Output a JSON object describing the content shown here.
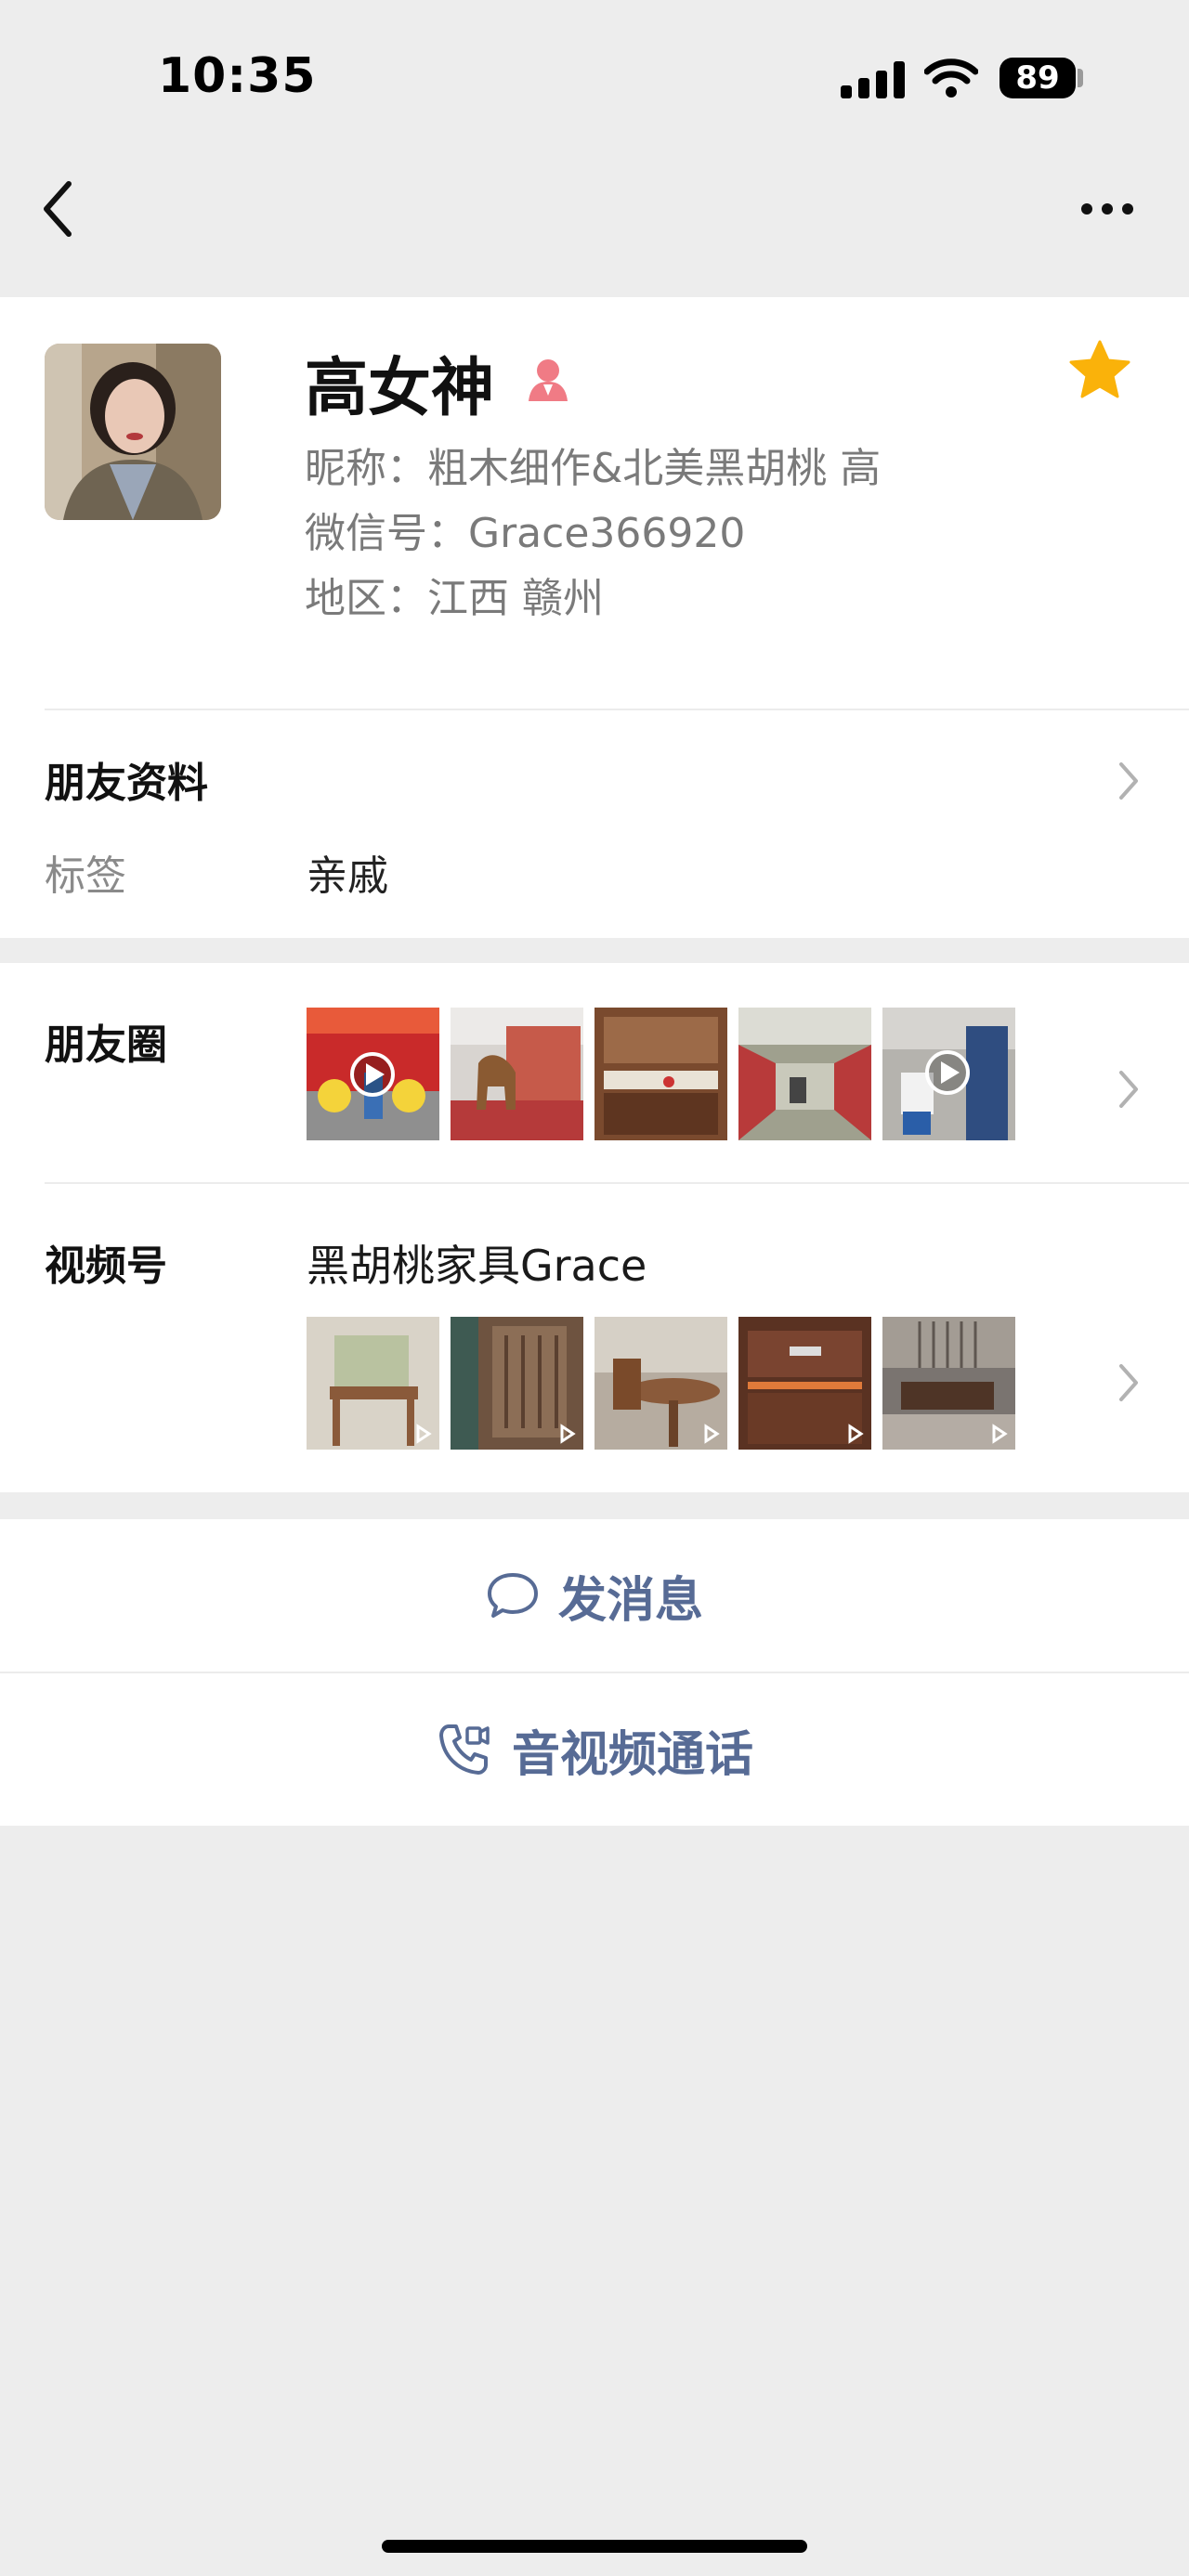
{
  "status_bar": {
    "time": "10:35",
    "battery": "89"
  },
  "navbar": {
    "back_icon": "chevron-left-icon",
    "more_icon": "more-dots-icon"
  },
  "profile": {
    "display_name": "高女神",
    "gender_icon": "female-icon",
    "starred": true,
    "nickname": "昵称：粗木细作&北美黑胡桃 高",
    "wechat_id": "微信号：Grace366920",
    "region": "地区：江西 赣州"
  },
  "friend_info": {
    "title": "朋友资料",
    "tag_label": "标签",
    "tag_value": "亲戚"
  },
  "moments": {
    "title": "朋友圈",
    "thumbnails": [
      {
        "name": "moment-lion-dance",
        "is_video": true
      },
      {
        "name": "moment-horse-statue",
        "is_video": false
      },
      {
        "name": "moment-cabinet",
        "is_video": false
      },
      {
        "name": "moment-subway",
        "is_video": false
      },
      {
        "name": "moment-child-walking",
        "is_video": true
      }
    ]
  },
  "channels": {
    "title": "视频号",
    "name": "黑胡桃家具Grace",
    "thumbnails": [
      {
        "name": "channel-chair"
      },
      {
        "name": "channel-wood-panel"
      },
      {
        "name": "channel-dining-table"
      },
      {
        "name": "channel-sideboard"
      },
      {
        "name": "channel-living-room"
      }
    ]
  },
  "actions": {
    "send_message": "发消息",
    "av_call": "音视频通话"
  },
  "colors": {
    "link_blue": "#576b95",
    "star_yellow": "#fab20a",
    "female_pink": "#f07b85",
    "background_gray": "#ededed"
  }
}
